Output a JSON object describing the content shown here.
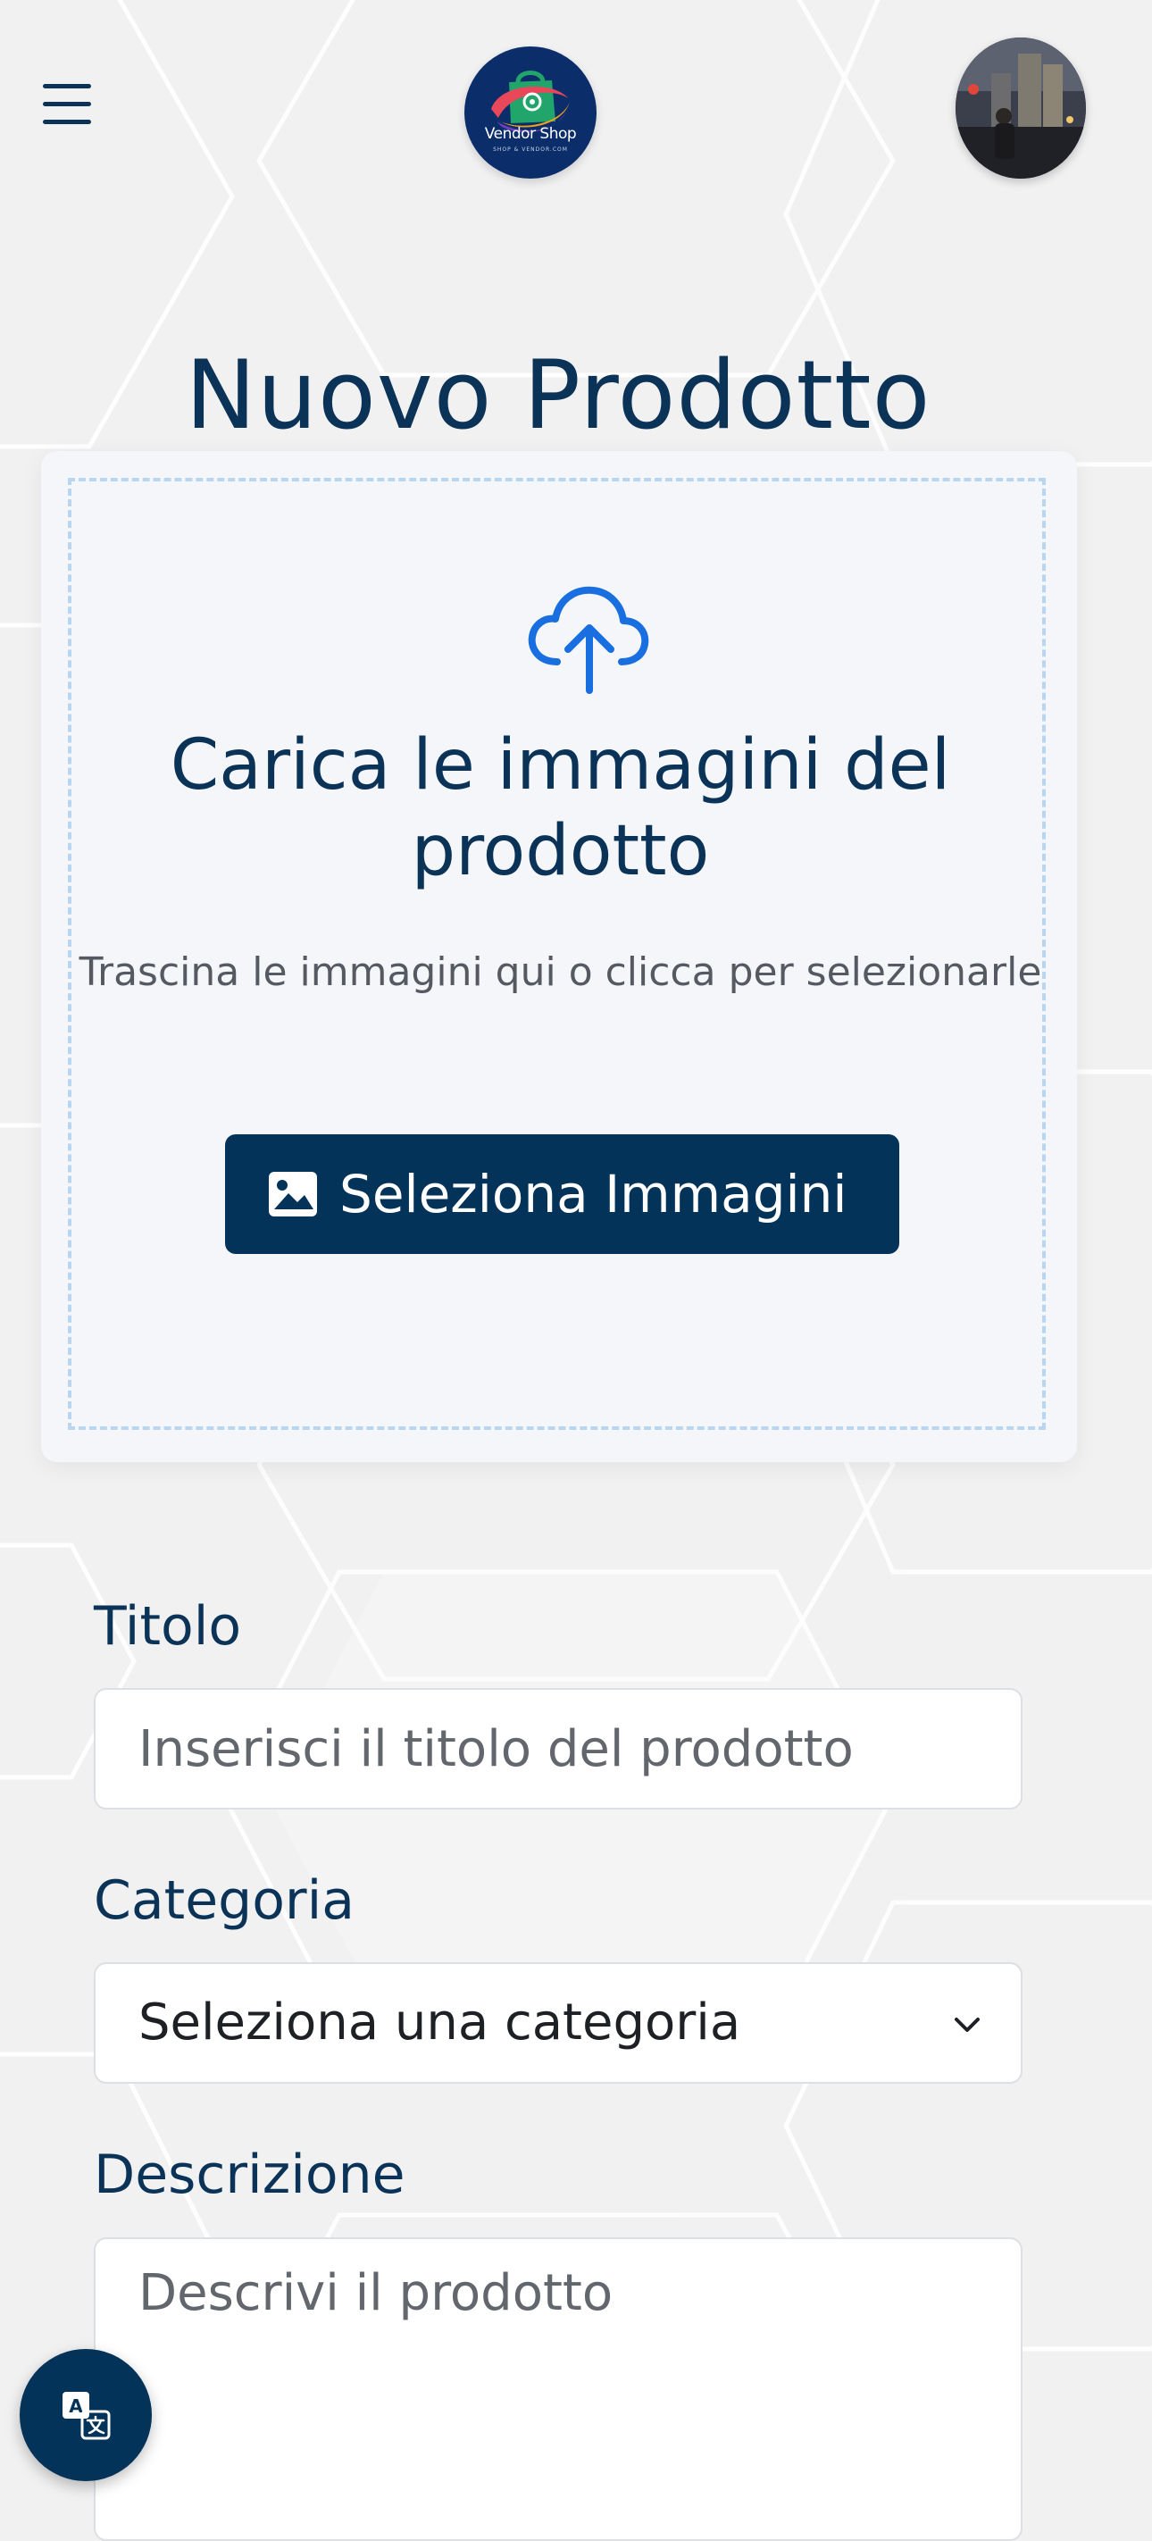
{
  "header": {
    "menu_icon": "hamburger-menu-icon",
    "logo": {
      "brand": "Vendor Shop",
      "tagline": "SHOP & VENDOR.COM"
    },
    "avatar_icon": "user-avatar"
  },
  "page": {
    "title": "Nuovo Prodotto"
  },
  "upload": {
    "icon": "cloud-upload-icon",
    "title": "Carica le immagini del prodotto",
    "hint": "Trascina le immagini qui o clicca per selezionarle",
    "button_icon": "image-icon",
    "button_label": "Seleziona Immagini"
  },
  "form": {
    "title": {
      "label": "Titolo",
      "value": "",
      "placeholder": "Inserisci il titolo del prodotto"
    },
    "category": {
      "label": "Categoria",
      "selected": "Seleziona una categoria"
    },
    "description": {
      "label": "Descrizione",
      "value": "",
      "placeholder": "Descrivi il prodotto"
    }
  },
  "fab": {
    "icon": "translate-icon"
  },
  "colors": {
    "primary": "#04335a",
    "accent": "#1a6fe0",
    "background": "#f1f1f2",
    "dropzone_border": "#b8d6ef"
  }
}
